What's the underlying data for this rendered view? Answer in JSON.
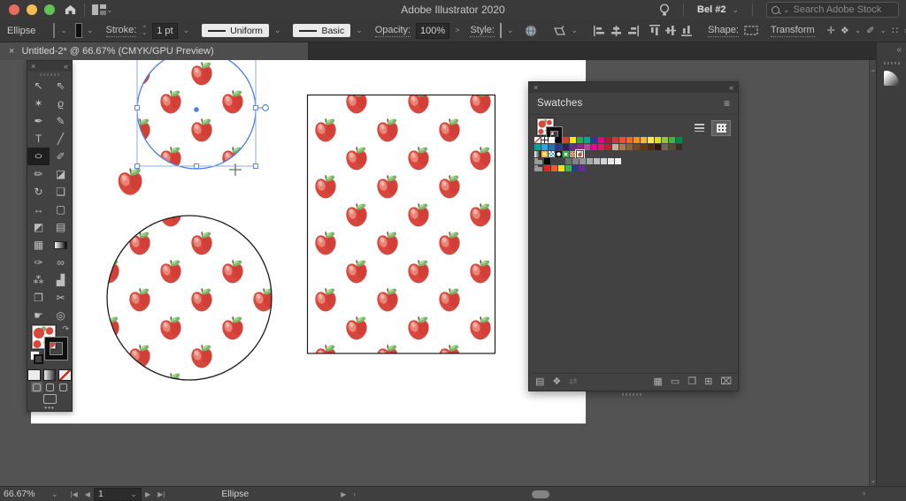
{
  "icons": {
    "chevron_down": "⌄",
    "chevron_up": "⌃",
    "chevron_left": "‹",
    "chevron_right": "›",
    "collapse": "«",
    "close": "×",
    "menu": "≡",
    "ellipsis": "•••",
    "swap": "↷",
    "prev": "◀",
    "next": "▶",
    "first": "|◀",
    "last": "▶|",
    "greater": ">"
  },
  "menubar": {
    "title": "Adobe Illustrator 2020",
    "user_label": "Bel #2",
    "search_placeholder": "Search Adobe Stock"
  },
  "controlbar": {
    "selection_label": "Ellipse",
    "stroke_label": "Stroke:",
    "stroke_weight": "1 pt",
    "variable_width_profile": "Uniform",
    "brush_definition": "Basic",
    "opacity_label": "Opacity:",
    "opacity_value": "100%",
    "style_label": "Style:",
    "shape_label": "Shape:",
    "transform_label": "Transform"
  },
  "document_tab": {
    "title": "Untitled-2* @ 66.67% (CMYK/GPU Preview)"
  },
  "toolbar": {
    "tools": [
      {
        "name": "selection-tool",
        "glyph": "↖"
      },
      {
        "name": "direct-selection-tool",
        "glyph": "⇖"
      },
      {
        "name": "magic-wand-tool",
        "glyph": "✶"
      },
      {
        "name": "lasso-tool",
        "glyph": "ϱ"
      },
      {
        "name": "pen-tool",
        "glyph": "✒"
      },
      {
        "name": "curvature-tool",
        "glyph": "✎"
      },
      {
        "name": "type-tool",
        "glyph": "T"
      },
      {
        "name": "line-segment-tool",
        "glyph": "╱"
      },
      {
        "name": "ellipse-tool",
        "glyph": "○",
        "active": true,
        "wide": true
      },
      {
        "name": "paintbrush-tool",
        "glyph": "✐"
      },
      {
        "name": "shaper-tool",
        "glyph": "✏"
      },
      {
        "name": "eraser-tool",
        "glyph": "◪"
      },
      {
        "name": "rotate-tool",
        "glyph": "↻"
      },
      {
        "name": "scale-tool",
        "glyph": "❏"
      },
      {
        "name": "width-tool",
        "glyph": "↔"
      },
      {
        "name": "free-transform-tool",
        "glyph": "▢"
      },
      {
        "name": "shape-builder-tool",
        "glyph": "◩"
      },
      {
        "name": "perspective-grid-tool",
        "glyph": "▤"
      },
      {
        "name": "mesh-tool",
        "glyph": "▦"
      },
      {
        "name": "gradient-tool",
        "glyph": "",
        "grad": true
      },
      {
        "name": "eyedropper-tool",
        "glyph": "✑"
      },
      {
        "name": "blend-tool",
        "glyph": "∞"
      },
      {
        "name": "symbol-sprayer-tool",
        "glyph": "⁂"
      },
      {
        "name": "graph-tool",
        "glyph": "▟"
      },
      {
        "name": "artboard-tool",
        "glyph": "❐"
      },
      {
        "name": "slice-tool",
        "glyph": "✂"
      },
      {
        "name": "hand-tool",
        "glyph": "☛"
      },
      {
        "name": "zoom-tool",
        "glyph": "◎"
      }
    ]
  },
  "swatches_panel": {
    "title": "Swatches",
    "rows": [
      [
        "none",
        "registration",
        "#ffffff",
        "#000000",
        "#e8372c",
        "#fde900",
        "#28a952",
        "#00a79b",
        "#2a3b8f",
        "#eb008b",
        "#a31e31",
        "#cf3a32",
        "#e95532",
        "#f26a23",
        "#f6911e",
        "#fbb042",
        "#ffe94f",
        "#d9e021",
        "#8dc63f",
        "#3cb549",
        "#008c44"
      ],
      [
        "#00a79d",
        "#27aae1",
        "#1b75bb",
        "#2b3990",
        "#262261",
        "#652d90",
        "#91278f",
        "#b4459c",
        "#ec008c",
        "#db1c5e",
        "#be1e2d",
        "#c7b299",
        "#a97c50",
        "#8b6239",
        "#77471f",
        "#603913",
        "#4a2a10",
        "#32180a",
        "#6e6558",
        "#55493c",
        "#3a2f24"
      ],
      [
        "gradient-bw",
        "gradient-radial",
        "pattern-checks",
        "pattern-dot",
        "pattern-square",
        "pattern-speckle",
        "pattern-apple-selected"
      ],
      [
        "folder",
        "#000000",
        "#414042",
        "gap",
        "#6d6e71",
        "#808285",
        "#939598",
        "#a7a9ac",
        "#bcbec0",
        "#d1d3d4",
        "#e6e7e8",
        "#f1f2f2"
      ],
      [
        "folder",
        "#ed1c24",
        "#f15a29",
        "#ffde17",
        "#39b54a",
        "#2b3990",
        "#662d91"
      ]
    ],
    "footer_left": [
      {
        "name": "swatch-libraries-menu-icon",
        "glyph": "▤"
      },
      {
        "name": "show-swatch-kinds-icon",
        "glyph": "❖"
      },
      {
        "name": "swatch-sync-icon",
        "glyph": "⇄",
        "disabled": true
      }
    ],
    "footer_right": [
      {
        "name": "add-to-library-icon",
        "glyph": "▦"
      },
      {
        "name": "swatch-options-icon",
        "glyph": "▭"
      },
      {
        "name": "new-color-group-icon",
        "glyph": "❐"
      },
      {
        "name": "new-swatch-icon",
        "glyph": "⊞"
      },
      {
        "name": "delete-swatch-icon",
        "glyph": "⌧"
      }
    ]
  },
  "statusbar": {
    "zoom_level": "66.67%",
    "artboard_number": "1",
    "current_tool": "Ellipse"
  },
  "colors": {
    "apple_red": "#d8473d",
    "apple_leaf": "#7bb56a",
    "selection_blue": "#4c7fe1",
    "traffic_close": "#ee6a5f",
    "traffic_minimize": "#f5bd4f",
    "traffic_maximize": "#61c354"
  }
}
